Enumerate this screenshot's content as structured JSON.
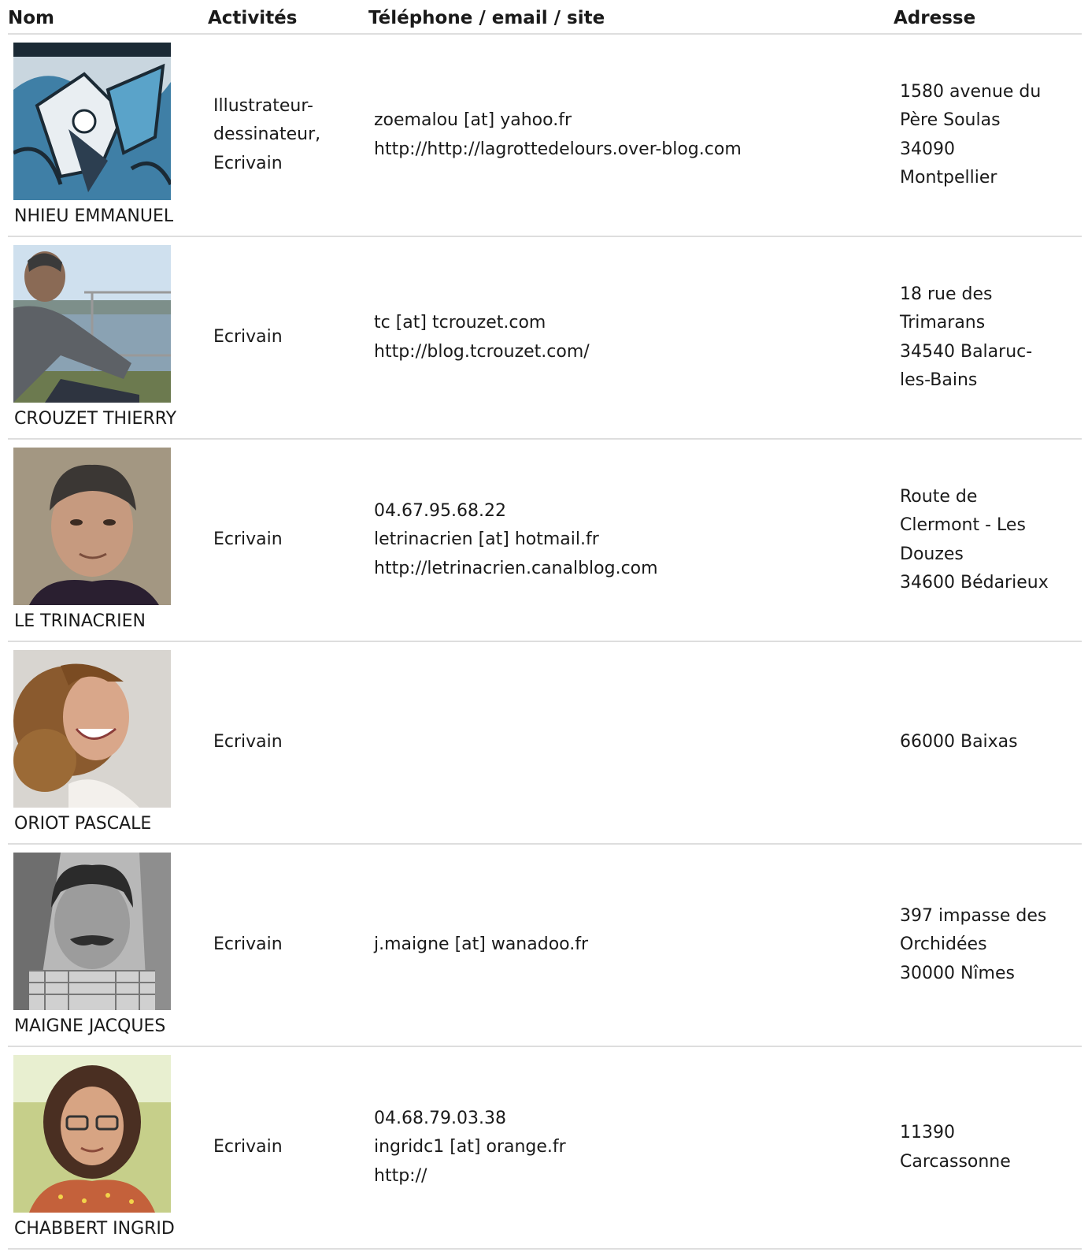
{
  "columns": {
    "nom": "Nom",
    "activites": "Activités",
    "contact": "Téléphone / email / site",
    "adresse": "Adresse"
  },
  "rows": [
    {
      "name": "NHIEU EMMANUEL",
      "photo": "comic-cover-illustration",
      "activity": [
        "Illustrateur-",
        "dessinateur,",
        "Ecrivain"
      ],
      "contact": [
        "zoemalou [at] yahoo.fr",
        "http://http://lagrottedelours.over-blog.com"
      ],
      "address": [
        "1580 avenue du",
        "Père Soulas",
        "34090",
        "Montpellier"
      ]
    },
    {
      "name": "CROUZET THIERRY",
      "photo": "man-by-sea-photo",
      "activity": [
        "Ecrivain"
      ],
      "contact": [
        "tc [at] tcrouzet.com",
        "http://blog.tcrouzet.com/"
      ],
      "address": [
        "18 rue des",
        "Trimarans",
        "34540 Balaruc-",
        "les-Bains"
      ]
    },
    {
      "name": "LE TRINACRIEN",
      "photo": "man-portrait-photo",
      "activity": [
        "Ecrivain"
      ],
      "contact": [
        "04.67.95.68.22",
        "letrinacrien [at] hotmail.fr",
        "http://letrinacrien.canalblog.com"
      ],
      "address": [
        "Route de",
        "Clermont - Les",
        "Douzes",
        "34600 Bédarieux"
      ]
    },
    {
      "name": "ORIOT PASCALE",
      "photo": "woman-curly-hair-photo",
      "activity": [
        "Ecrivain"
      ],
      "contact": [],
      "address": [
        "66000 Baixas"
      ]
    },
    {
      "name": "MAIGNE JACQUES",
      "photo": "man-mustache-bw-photo",
      "activity": [
        "Ecrivain"
      ],
      "contact": [
        "j.maigne [at] wanadoo.fr"
      ],
      "address": [
        "397 impasse des",
        "Orchidées",
        "30000 Nîmes"
      ]
    },
    {
      "name": "CHABBERT INGRID",
      "photo": "woman-glasses-photo",
      "activity": [
        "Ecrivain"
      ],
      "contact": [
        "04.68.79.03.38",
        "ingridc1 [at] orange.fr",
        "http://"
      ],
      "address": [
        "11390",
        "Carcassonne"
      ]
    }
  ]
}
